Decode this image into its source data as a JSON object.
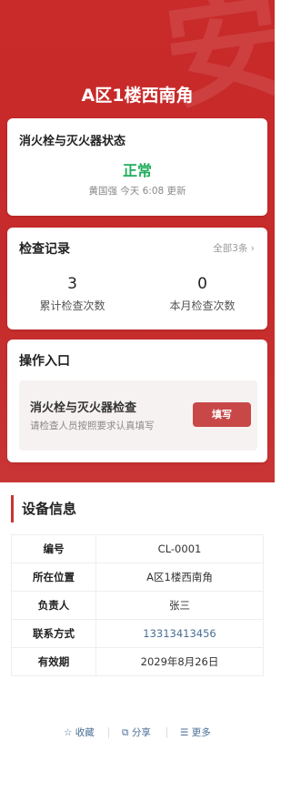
{
  "hero": {
    "title": "A区1楼西南角",
    "watermark": "安"
  },
  "status_card": {
    "title": "消火栓与灭火器状态",
    "status": "正常",
    "meta": "黄国强 今天 6:08 更新",
    "status_color": "#1fae5b"
  },
  "records_card": {
    "title": "检查记录",
    "all_link": "全部3条 ›",
    "stats": [
      {
        "value": "3",
        "label": "累计检查次数"
      },
      {
        "value": "0",
        "label": "本月检查次数"
      }
    ]
  },
  "ops_card": {
    "title": "操作入口",
    "item_title": "消火栓与灭火器检查",
    "item_desc": "请检查人员按照要求认真填写",
    "button": "填写"
  },
  "device": {
    "section_title": "设备信息",
    "rows": [
      {
        "key": "编号",
        "value": "CL-0001"
      },
      {
        "key": "所在位置",
        "value": "A区1楼西南角"
      },
      {
        "key": "负责人",
        "value": "张三"
      },
      {
        "key": "联系方式",
        "value": "13313413456"
      },
      {
        "key": "有效期",
        "value": "2029年8月26日"
      }
    ]
  },
  "footer": {
    "favorite": "☆ 收藏",
    "share": "⧉ 分享",
    "more": "☰ 更多"
  },
  "colors": {
    "brand_red": "#c93434",
    "link_blue": "#4a6f94"
  }
}
